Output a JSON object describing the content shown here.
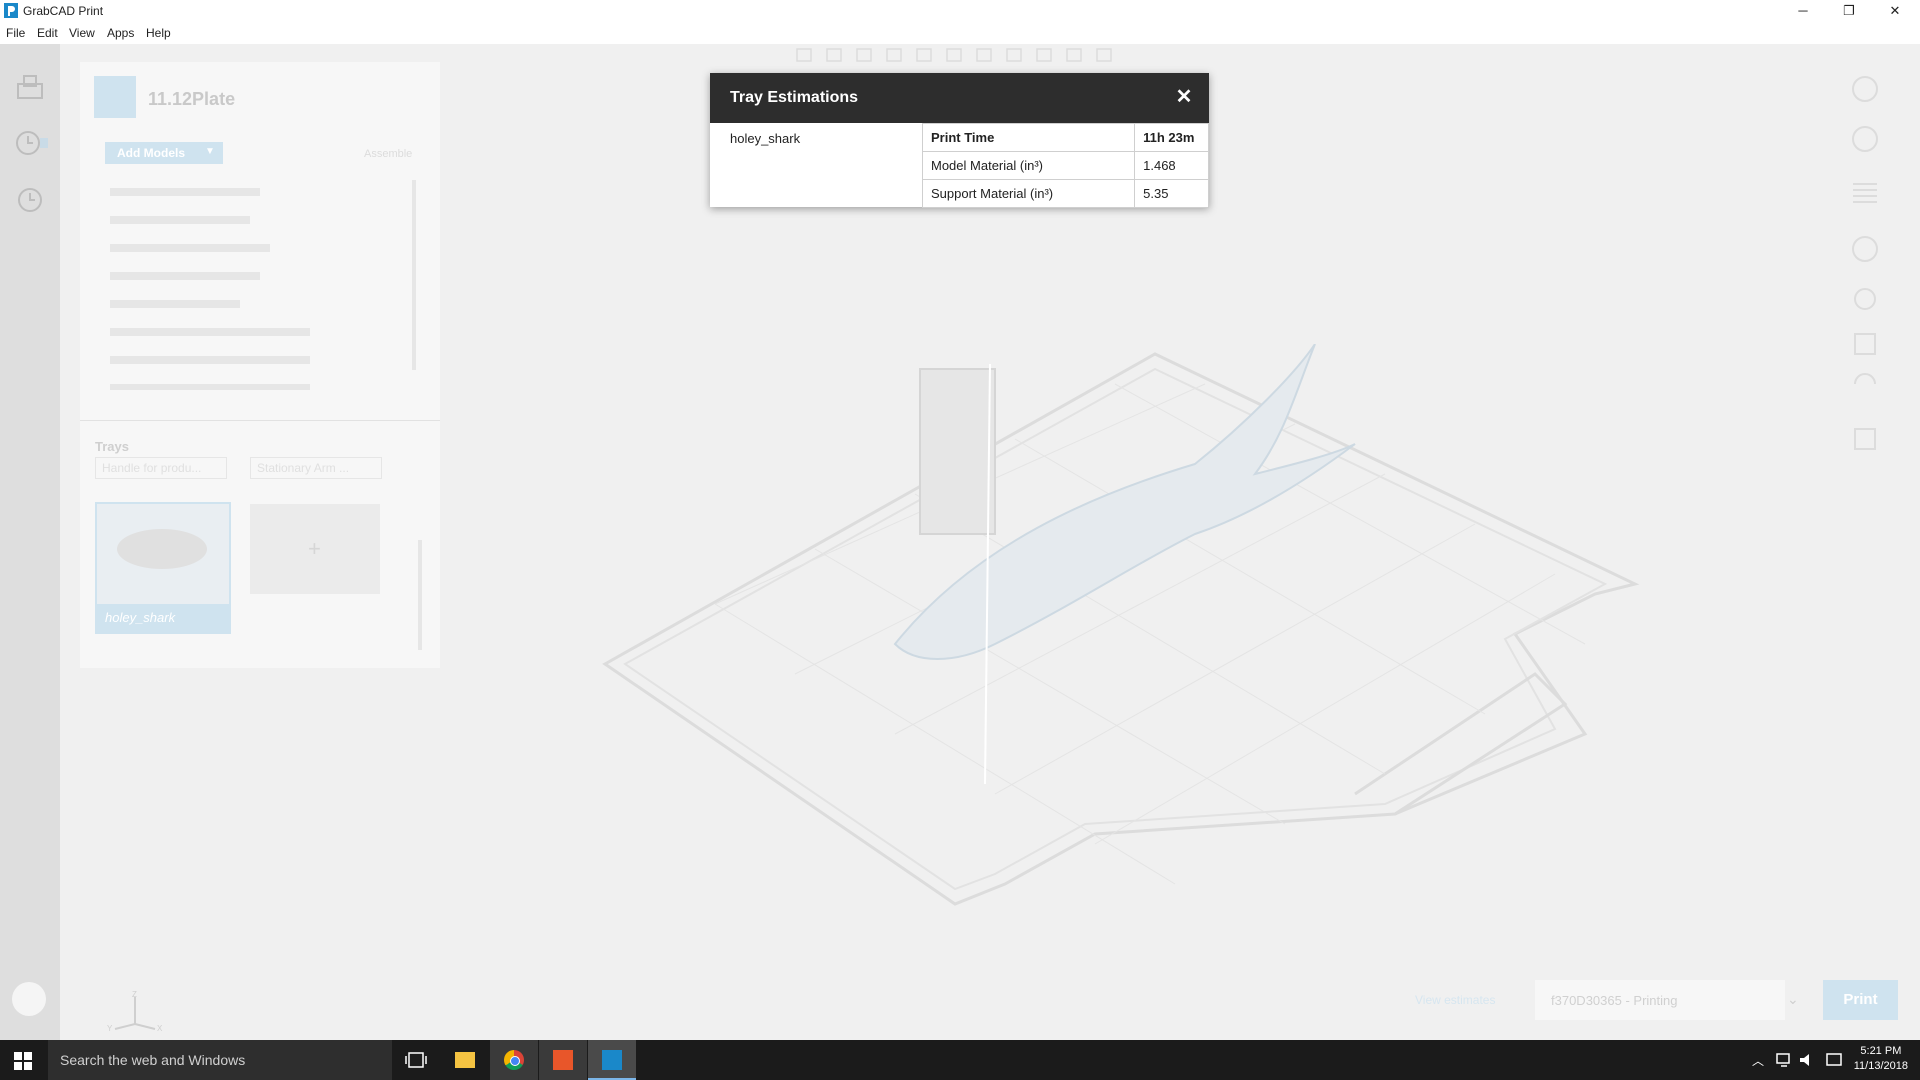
{
  "window": {
    "title": "GrabCAD Print",
    "controls": [
      "─",
      "❐",
      "✕"
    ]
  },
  "menu": [
    "File",
    "Edit",
    "View",
    "Apps",
    "Help"
  ],
  "left_panel": {
    "project_title": "11.12Plate",
    "add_models_label": "Add Models",
    "assemble_label": "Assemble",
    "trays_label": "Trays",
    "tray_tabs": [
      "Handle for produ...",
      "Stationary Arm ..."
    ],
    "tray_card_label": "holey_shark",
    "add_tray_symbol": "+"
  },
  "modal": {
    "title": "Tray Estimations",
    "model_name": "holey_shark",
    "rows": [
      {
        "label": "Print Time",
        "value": "11h 23m"
      },
      {
        "label": "Model Material (in³)",
        "value": "1.468"
      },
      {
        "label": "Support Material (in³)",
        "value": "5.35"
      }
    ]
  },
  "bottom_bar": {
    "view_estimates": "View estimates",
    "printer": "f370D30365 - Printing",
    "print_label": "Print"
  },
  "taskbar": {
    "search_placeholder": "Search the web and Windows",
    "time": "5:21 PM",
    "date": "11/13/2018"
  },
  "colors": {
    "modal_header": "#2d2d2d",
    "accent": "#1a88c9"
  }
}
